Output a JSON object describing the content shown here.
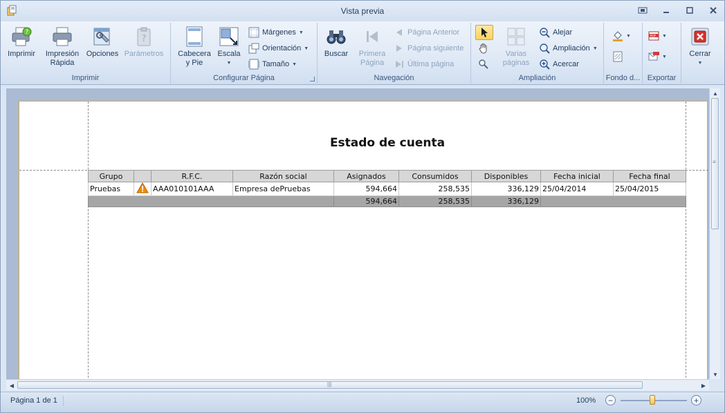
{
  "window": {
    "title": "Vista previa"
  },
  "ribbon": {
    "imprimir": {
      "label": "Imprimir",
      "buttons": {
        "print": "Imprimir",
        "quick_print": "Impresión\nRápida",
        "options": "Opciones",
        "parameters": "Parámetros"
      }
    },
    "configurar": {
      "label": "Configurar Página",
      "buttons": {
        "header_footer": "Cabecera\ny Pie",
        "scale": "Escala",
        "margins": "Márgenes",
        "orientation": "Orientación",
        "size": "Tamaño"
      }
    },
    "navegacion": {
      "label": "Navegación",
      "buttons": {
        "find": "Buscar",
        "first_page": "Primera\nPágina",
        "prev_page": "Página Anterior",
        "next_page": "Página siguiente",
        "last_page": "Última página"
      }
    },
    "ampliacion": {
      "label": "Ampliación",
      "buttons": {
        "multiple_pages": "Varias\npáginas",
        "zoom_out": "Alejar",
        "zoom": "Ampliación",
        "zoom_in": "Acercar"
      }
    },
    "fondo": {
      "label": "Fondo d..."
    },
    "exportar": {
      "label": "Exportar"
    },
    "cerrar": {
      "label": "Cerrar"
    }
  },
  "report": {
    "title": "Estado de cuenta",
    "columns": [
      "Grupo",
      "",
      "R.F.C.",
      "Razón social",
      "Asignados",
      "Consumidos",
      "Disponibles",
      "Fecha inicial",
      "Fecha final"
    ],
    "rows": [
      {
        "grupo": "Pruebas",
        "rfc": "AAA010101AAA",
        "razon_social": "Empresa dePruebas",
        "asignados": "594,664",
        "consumidos": "258,535",
        "disponibles": "336,129",
        "fecha_inicial": "25/04/2014",
        "fecha_final": "25/04/2015"
      }
    ],
    "totals": {
      "asignados": "594,664",
      "consumidos": "258,535",
      "disponibles": "336,129"
    }
  },
  "status": {
    "page_info": "Página 1 de 1",
    "zoom": "100%",
    "zoom_fraction": 0.5
  },
  "colors": {
    "warning": "#f08c00",
    "page_border": "#e2a93a",
    "header_bg": "#d7d7d7",
    "total_bg": "#a6a6a6"
  }
}
